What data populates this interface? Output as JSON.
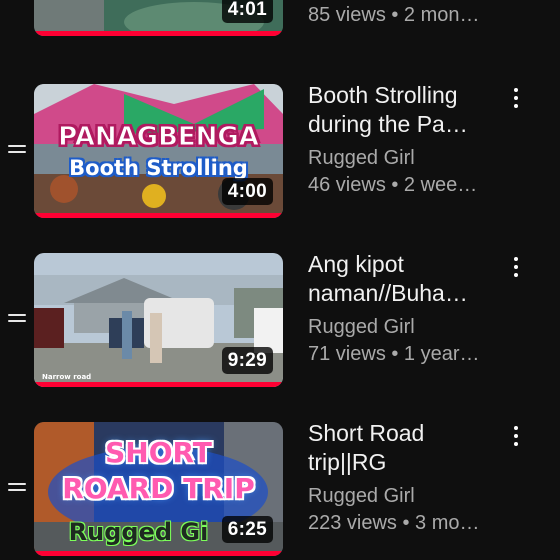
{
  "colors": {
    "background": "#0f0f0f",
    "progress": "#ff0033",
    "secondary_text": "#aaaaaa"
  },
  "videos": [
    {
      "duration": "4:01",
      "title_lines": [],
      "channel": "",
      "stats": "85 views • 2 mon…"
    },
    {
      "duration": "4:00",
      "title_lines": [
        "Booth Strolling",
        "during the Pa…"
      ],
      "channel": "Rugged Girl",
      "stats": "46 views • 2 wee…",
      "thumb_text": [
        "PANAGBENGA",
        "Booth Strolling"
      ]
    },
    {
      "duration": "9:29",
      "title_lines": [
        "Ang kipot",
        "naman//Buha…"
      ],
      "channel": "Rugged Girl",
      "stats": "71 views • 1 year…",
      "thumb_text": [
        "Narrow road"
      ]
    },
    {
      "duration": "6:25",
      "title_lines": [
        "Short Road",
        "trip||RG"
      ],
      "channel": "Rugged Girl",
      "stats": "223 views • 3 mo…",
      "thumb_text": [
        "SHORT",
        "ROARD TRIP",
        "Rugged Gi"
      ]
    }
  ],
  "icons": {
    "drag": "drag-handle-icon",
    "more": "more-vert-icon"
  }
}
